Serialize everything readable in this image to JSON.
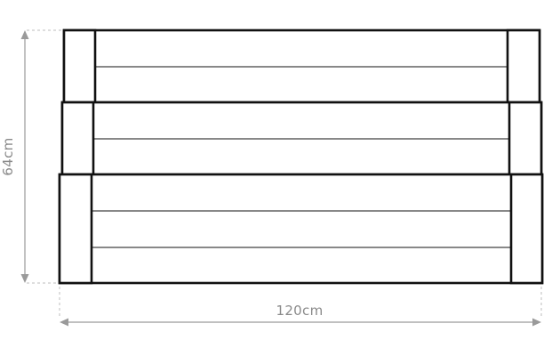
{
  "dimensions": {
    "height_label": "64cm",
    "width_label": "120cm"
  },
  "planter": {
    "tiers": [
      {
        "boards": 2
      },
      {
        "boards": 2
      },
      {
        "boards": 3
      }
    ]
  },
  "colors": {
    "outline": "#111111",
    "dimension": "#9a9a9a",
    "dimension_text": "#8a8a8a"
  }
}
